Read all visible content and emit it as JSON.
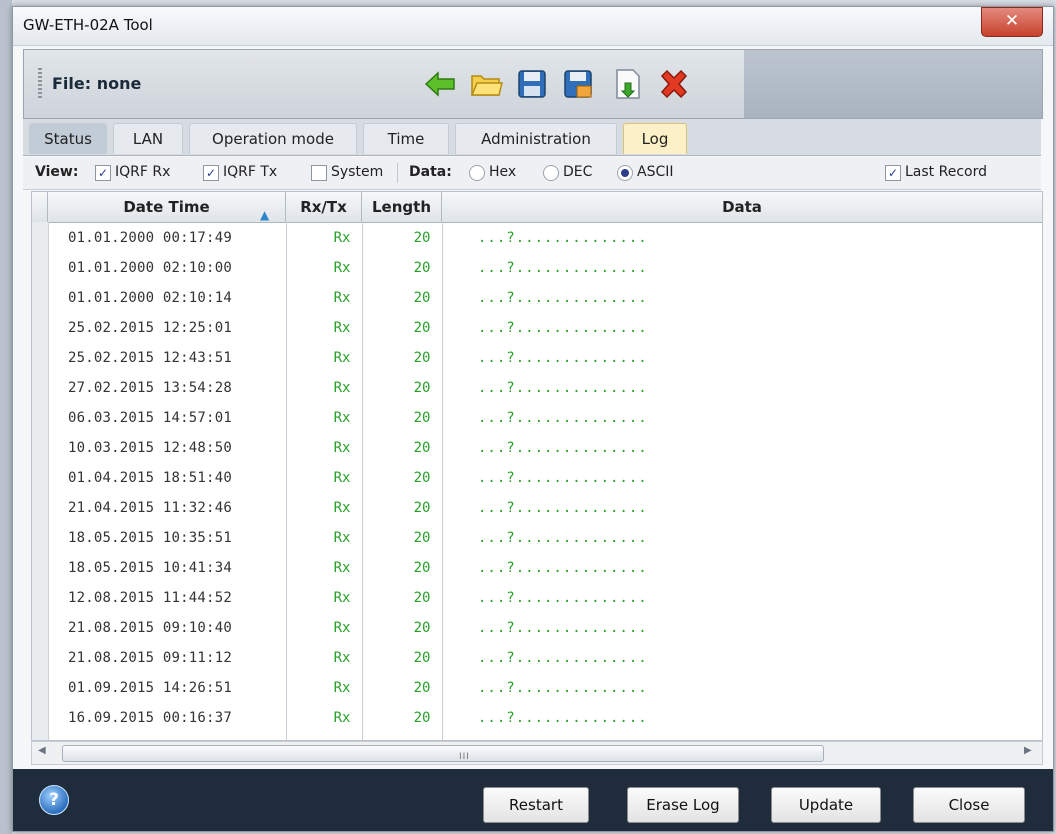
{
  "window": {
    "title": "GW-ETH-02A Tool",
    "close_glyph": "✕"
  },
  "file": {
    "label": "File: none"
  },
  "toolbar": {
    "icons": [
      "back-arrow-icon",
      "open-folder-icon",
      "save-icon",
      "save-as-icon",
      "export-icon",
      "delete-icon"
    ]
  },
  "tabs": [
    {
      "label": "Status"
    },
    {
      "label": "LAN"
    },
    {
      "label": "Operation mode"
    },
    {
      "label": "Time"
    },
    {
      "label": "Administration"
    },
    {
      "label": "Log",
      "active": true
    }
  ],
  "viewbar": {
    "view_label": "View:",
    "checks": [
      {
        "label": "IQRF Rx",
        "checked": true
      },
      {
        "label": "IQRF Tx",
        "checked": true
      },
      {
        "label": "System",
        "checked": false
      }
    ],
    "data_label": "Data:",
    "radios": [
      {
        "label": "Hex",
        "selected": false
      },
      {
        "label": "DEC",
        "selected": false
      },
      {
        "label": "ASCII",
        "selected": true
      }
    ],
    "last_record": {
      "label": "Last Record",
      "checked": true
    }
  },
  "grid": {
    "columns": [
      "Date Time",
      "Rx/Tx",
      "Length",
      "Data"
    ],
    "rows": [
      {
        "dt": "01.01.2000 00:17:49",
        "rxtx": "Rx",
        "len": "20",
        "data": "...?.............."
      },
      {
        "dt": "01.01.2000 02:10:00",
        "rxtx": "Rx",
        "len": "20",
        "data": "...?.............."
      },
      {
        "dt": "01.01.2000 02:10:14",
        "rxtx": "Rx",
        "len": "20",
        "data": "...?.............."
      },
      {
        "dt": "25.02.2015 12:25:01",
        "rxtx": "Rx",
        "len": "20",
        "data": "...?.............."
      },
      {
        "dt": "25.02.2015 12:43:51",
        "rxtx": "Rx",
        "len": "20",
        "data": "...?.............."
      },
      {
        "dt": "27.02.2015 13:54:28",
        "rxtx": "Rx",
        "len": "20",
        "data": "...?.............."
      },
      {
        "dt": "06.03.2015 14:57:01",
        "rxtx": "Rx",
        "len": "20",
        "data": "...?.............."
      },
      {
        "dt": "10.03.2015 12:48:50",
        "rxtx": "Rx",
        "len": "20",
        "data": "...?.............."
      },
      {
        "dt": "01.04.2015 18:51:40",
        "rxtx": "Rx",
        "len": "20",
        "data": "...?.............."
      },
      {
        "dt": "21.04.2015 11:32:46",
        "rxtx": "Rx",
        "len": "20",
        "data": "...?.............."
      },
      {
        "dt": "18.05.2015 10:35:51",
        "rxtx": "Rx",
        "len": "20",
        "data": "...?.............."
      },
      {
        "dt": "18.05.2015 10:41:34",
        "rxtx": "Rx",
        "len": "20",
        "data": "...?.............."
      },
      {
        "dt": "12.08.2015 11:44:52",
        "rxtx": "Rx",
        "len": "20",
        "data": "...?.............."
      },
      {
        "dt": "21.08.2015 09:10:40",
        "rxtx": "Rx",
        "len": "20",
        "data": "...?.............."
      },
      {
        "dt": "21.08.2015 09:11:12",
        "rxtx": "Rx",
        "len": "20",
        "data": "...?.............."
      },
      {
        "dt": "01.09.2015 14:26:51",
        "rxtx": "Rx",
        "len": "20",
        "data": "...?.............."
      },
      {
        "dt": "16.09.2015 00:16:37",
        "rxtx": "Rx",
        "len": "20",
        "data": "...?.............."
      }
    ]
  },
  "hscroll": {
    "grip": "III"
  },
  "footer": {
    "help_glyph": "?",
    "buttons": [
      "Restart",
      "Erase Log",
      "Update",
      "Close"
    ]
  },
  "colors": {
    "accent_green": "#2aa12a",
    "footer_bg": "#1f2c3b",
    "active_tab": "#fbf0c6"
  }
}
